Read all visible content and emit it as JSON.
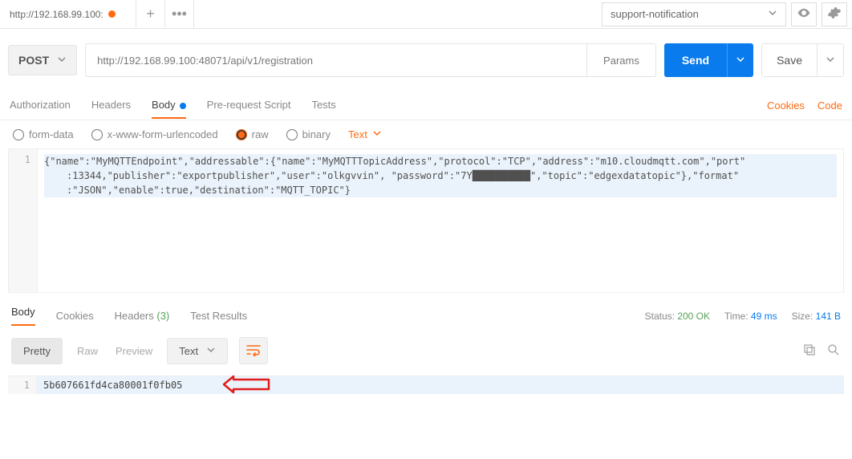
{
  "topbar": {
    "tab_url": "http://192.168.99.100:",
    "env_name": "support-notification"
  },
  "request": {
    "method": "POST",
    "url": "http://192.168.99.100:48071/api/v1/registration",
    "params_label": "Params",
    "send_label": "Send",
    "save_label": "Save"
  },
  "tabs": {
    "auth": "Authorization",
    "headers": "Headers",
    "body": "Body",
    "prescript": "Pre-request Script",
    "tests": "Tests",
    "cookies": "Cookies",
    "code": "Code"
  },
  "bodyopts": {
    "formdata": "form-data",
    "xwww": "x-www-form-urlencoded",
    "raw": "raw",
    "binary": "binary",
    "type": "Text"
  },
  "editor": {
    "line_no": "1",
    "l1": "{\"name\":\"MyMQTTEndpoint\",\"addressable\":{\"name\":\"MyMQTTTopicAddress\",\"protocol\":\"TCP\",\"address\":\"m10.cloudmqtt.com\",\"port\"",
    "l2": ":13344,\"publisher\":\"exportpublisher\",\"user\":\"olkgvvin\", \"password\":\"7Y██████████\",\"topic\":\"edgexdatatopic\"},\"format\"",
    "l3": ":\"JSON\",\"enable\":true,\"destination\":\"MQTT_TOPIC\"}"
  },
  "response": {
    "body": "Body",
    "cookies": "Cookies",
    "headers": "Headers",
    "headers_count": "(3)",
    "tests": "Test Results",
    "status_label": "Status:",
    "status_value": "200 OK",
    "time_label": "Time:",
    "time_value": "49 ms",
    "size_label": "Size:",
    "size_value": "141 B",
    "pretty": "Pretty",
    "raw": "Raw",
    "preview": "Preview",
    "fmt": "Text",
    "out_line": "1",
    "output": "5b607661fd4ca80001f0fb05"
  }
}
